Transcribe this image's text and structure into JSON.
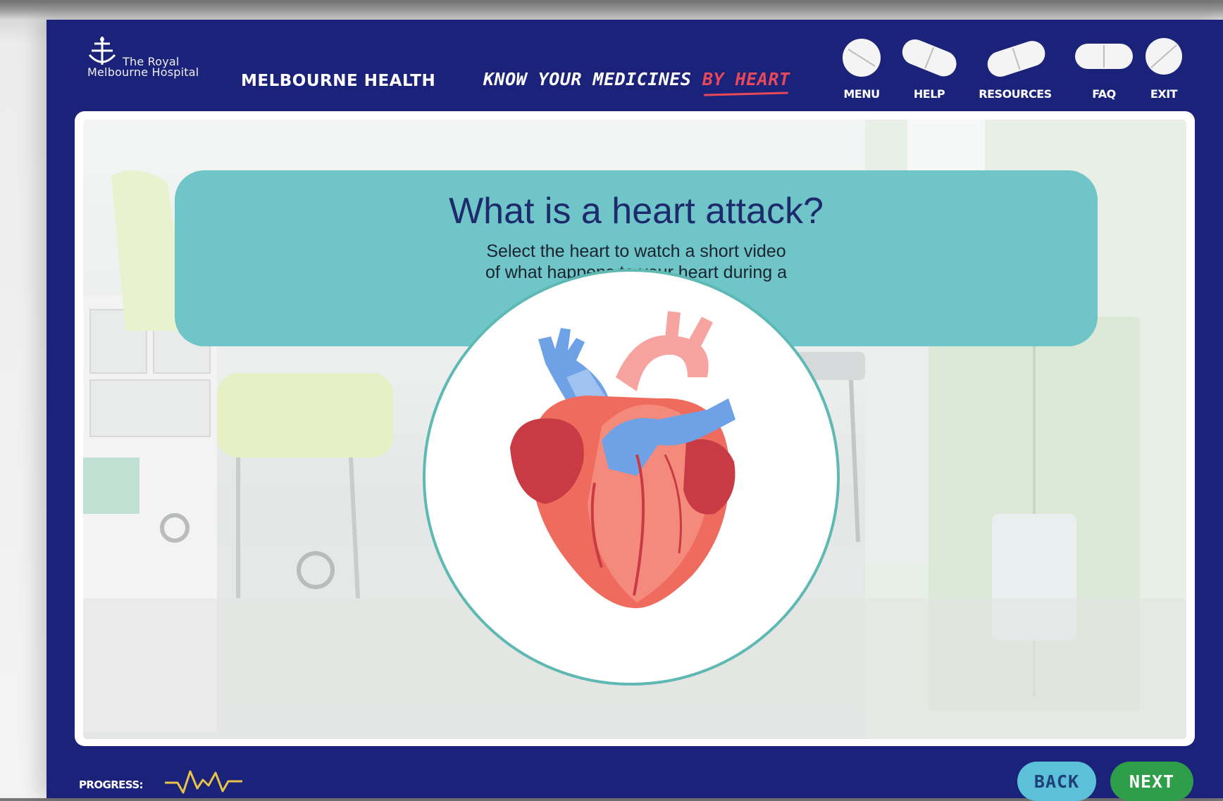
{
  "header": {
    "logo": {
      "line1": "The Royal",
      "line2": "Melbourne Hospital"
    },
    "org_name": "MELBOURNE HEALTH",
    "course_title": {
      "main": "KNOW YOUR MEDICINES ",
      "accent": "BY HEART",
      "accent_color": "#e8495a"
    }
  },
  "nav": {
    "menu": "MENU",
    "help": "HELP",
    "resources": "RESOURCES",
    "faq": "FAQ",
    "exit": "EXIT"
  },
  "main": {
    "title": "What is a heart attack?",
    "subtitle": "Select the heart to watch a short video of what happens to your heart during a heart attack.",
    "heart_icon": "heart-anatomy-icon",
    "panel_color": "#6fc5c7"
  },
  "footer": {
    "progress_label": "PROGRESS:",
    "progress_icon": "heartbeat-icon",
    "back_label": "BACK",
    "next_label": "NEXT"
  },
  "colors": {
    "frame": "#1b227a",
    "next": "#2e9e4a",
    "back": "#5bc0d8"
  }
}
